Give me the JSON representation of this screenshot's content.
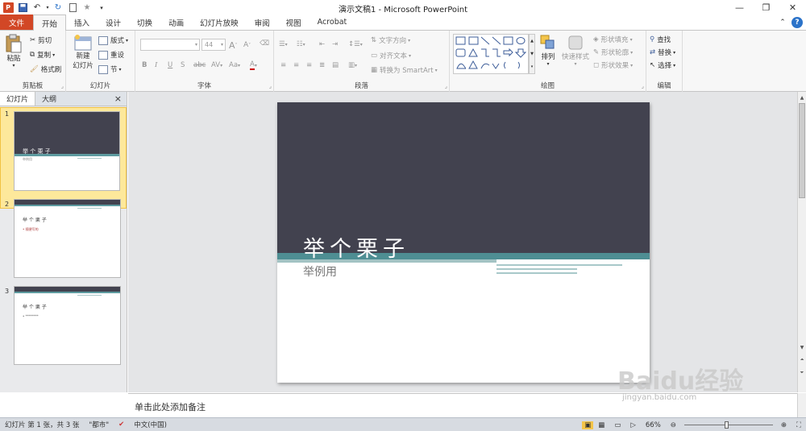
{
  "app": {
    "title": "演示文稿1 - Microsoft PowerPoint"
  },
  "tabs": [
    "文件",
    "开始",
    "插入",
    "设计",
    "切换",
    "动画",
    "幻灯片放映",
    "审阅",
    "视图",
    "Acrobat"
  ],
  "ribbon": {
    "clipboard": {
      "label": "剪贴板",
      "paste": "粘贴",
      "cut": "剪切",
      "copy": "复制",
      "format_painter": "格式刷"
    },
    "slides": {
      "label": "幻灯片",
      "new_slide": "新建\n幻灯片",
      "layout": "版式",
      "reset": "重设",
      "section": "节"
    },
    "font": {
      "label": "字体",
      "font_size": "44",
      "bold": "B",
      "italic": "I",
      "underline": "U",
      "shadow": "S",
      "strike": "abc",
      "spacing": "AV",
      "case": "Aa",
      "grow": "A",
      "shrink": "A"
    },
    "paragraph": {
      "label": "段落",
      "text_direction": "文字方向",
      "align_text": "对齐文本",
      "smartart": "转换为 SmartArt"
    },
    "drawing": {
      "label": "绘图",
      "arrange": "排列",
      "quick_styles": "快速样式",
      "shape_fill": "形状填充",
      "shape_outline": "形状轮廓",
      "shape_effects": "形状效果"
    },
    "editing": {
      "label": "编辑",
      "find": "查找",
      "replace": "替换",
      "select": "选择"
    }
  },
  "left_pane": {
    "tabs": [
      "幻灯片",
      "大纲"
    ],
    "close": "×",
    "thumbnails": [
      {
        "number": "1",
        "title": "举 个 栗 子",
        "subtitle": "举例用",
        "selected": true
      },
      {
        "number": "2",
        "title": "举 个 栗 子",
        "bullet": "• 随便写的",
        "selected": false
      },
      {
        "number": "3",
        "title": "举 个 栗 子",
        "bullet": "• ********",
        "selected": false
      }
    ]
  },
  "slide": {
    "title": "举个栗子",
    "subtitle": "举例用"
  },
  "notes": {
    "placeholder": "单击此处添加备注"
  },
  "status": {
    "slide_info": "幻灯片 第 1 张，共 3 张",
    "theme": "\"都市\"",
    "language": "中文(中国)",
    "zoom": "66%"
  },
  "watermark": {
    "text": "Baidu经验",
    "url": "jingyan.baidu.com"
  },
  "colors": {
    "accent": "#d24726",
    "slide_dark": "#42424f",
    "stripe": "#4e8e93"
  }
}
